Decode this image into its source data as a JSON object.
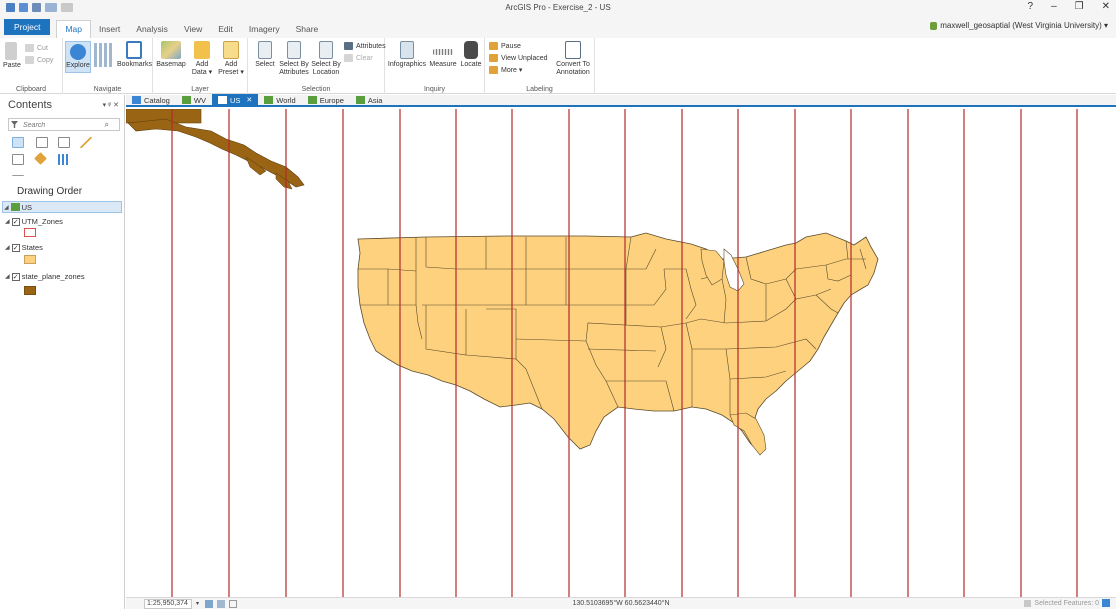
{
  "app": {
    "title": "ArcGIS Pro - Exercise_2 - US",
    "window_controls": [
      "?",
      "–",
      "❐",
      "✕"
    ],
    "user": "maxwell_geosaptial (West Virginia University) ▾"
  },
  "ribbon_tabs": [
    {
      "label": "Project"
    },
    {
      "label": "Map"
    },
    {
      "label": "Insert"
    },
    {
      "label": "Analysis"
    },
    {
      "label": "View"
    },
    {
      "label": "Edit"
    },
    {
      "label": "Imagery"
    },
    {
      "label": "Share"
    }
  ],
  "ribbon": {
    "clipboard": {
      "label": "Clipboard",
      "cut": "Cut",
      "copy": "Copy",
      "paste": "Paste"
    },
    "navigate": {
      "label": "Navigate",
      "explore": "Explore",
      "bookmarks": "Bookmarks"
    },
    "layer": {
      "label": "Layer",
      "basemap": "Basemap",
      "add_data": "Add",
      "add_data2": "Data ▾",
      "add_preset": "Add",
      "add_preset2": "Preset ▾"
    },
    "selection": {
      "label": "Selection",
      "select": "Select",
      "select_by_attr": "Select By",
      "select_by_attr2": "Attributes",
      "select_by_loc": "Select By",
      "select_by_loc2": "Location",
      "attributes": "Attributes",
      "clear": "Clear"
    },
    "inquiry": {
      "label": "Inquiry",
      "infographics": "Infographics",
      "measure": "Measure",
      "locate": "Locate"
    },
    "labeling": {
      "label": "Labeling",
      "pause": "Pause",
      "view_unplaced": "View Unplaced",
      "more": "More ▾",
      "convert": "Convert To",
      "convert2": "Annotation"
    }
  },
  "contents": {
    "title": "Contents",
    "controls": "▾ ᵠ ✕",
    "search_placeholder": "Search",
    "drawing_order": "Drawing Order",
    "map_name": "US",
    "layers": [
      {
        "name": "UTM_Zones",
        "checked": true,
        "swatch_fill": "#ffffff",
        "swatch_stroke": "#d9534f"
      },
      {
        "name": "States",
        "checked": true,
        "swatch_fill": "#fdd17e",
        "swatch_stroke": "#c8a060"
      },
      {
        "name": "state_plane_zones",
        "checked": true,
        "swatch_fill": "#996515",
        "swatch_stroke": "#7a4f10"
      }
    ]
  },
  "map_tabs": [
    {
      "label": "Catalog",
      "active": false
    },
    {
      "label": "WV",
      "active": false
    },
    {
      "label": "US",
      "active": true
    },
    {
      "label": "World",
      "active": false
    },
    {
      "label": "Europe",
      "active": false
    },
    {
      "label": "Asia",
      "active": false
    }
  ],
  "status": {
    "scale": "1:25,950,374",
    "coordinates": "130.5103695°W 60.5623440°N",
    "selected_features": "Selected Features: 0"
  },
  "colors": {
    "accent": "#1e73be",
    "utm_line": "#b22a2a",
    "state_fill": "#fdd17e",
    "alaska_fill": "#996515"
  }
}
